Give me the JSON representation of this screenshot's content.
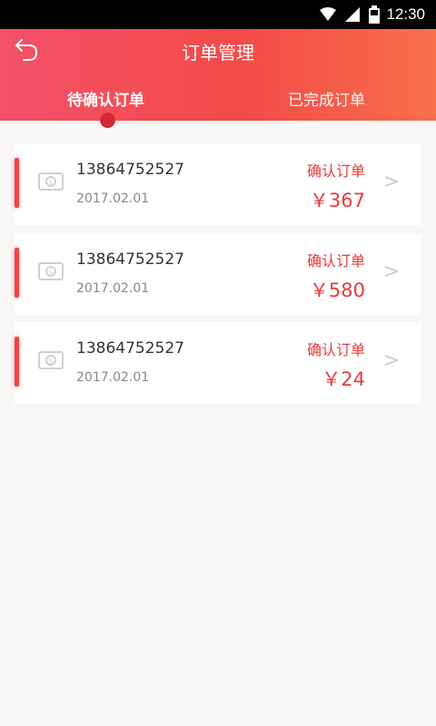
{
  "status_bar": {
    "time": "12:30"
  },
  "header": {
    "title": "订单管理",
    "tabs": [
      {
        "label": "待确认订单",
        "active": true
      },
      {
        "label": "已完成订单",
        "active": false
      }
    ]
  },
  "orders": [
    {
      "phone": "13864752527",
      "date": "2017.02.01",
      "action": "确认订单",
      "amount": "￥367"
    },
    {
      "phone": "13864752527",
      "date": "2017.02.01",
      "action": "确认订单",
      "amount": "￥580"
    },
    {
      "phone": "13864752527",
      "date": "2017.02.01",
      "action": "确认订单",
      "amount": "￥24"
    }
  ],
  "colors": {
    "accent": "#f24348",
    "header_start": "#f3506a",
    "header_end": "#f66f4a"
  }
}
